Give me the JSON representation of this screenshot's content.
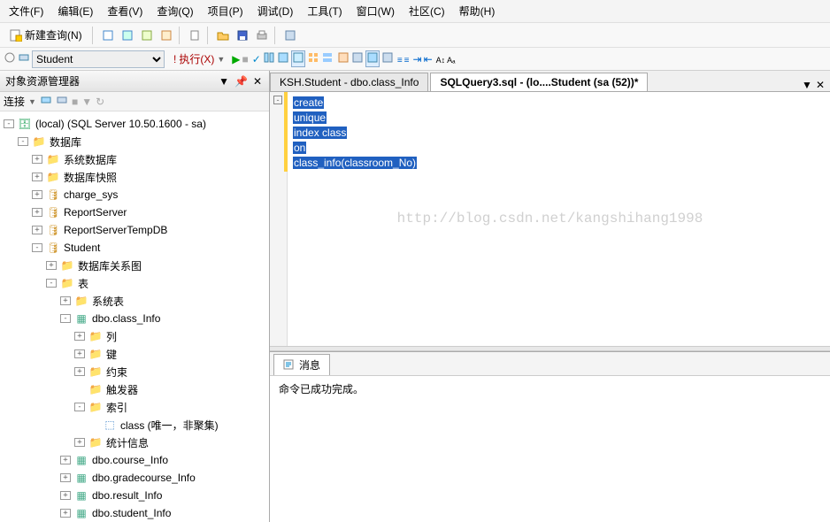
{
  "menu": {
    "file": "文件(F)",
    "edit": "编辑(E)",
    "view": "查看(V)",
    "query": "查询(Q)",
    "project": "项目(P)",
    "debug": "调试(D)",
    "tools": "工具(T)",
    "window": "窗口(W)",
    "community": "社区(C)",
    "help": "帮助(H)"
  },
  "toolbar": {
    "new_query": "新建查询(N)"
  },
  "toolbar2": {
    "db_select": "Student",
    "execute": "执行(X)"
  },
  "sidebar": {
    "title": "对象资源管理器",
    "connect": "连接"
  },
  "tree": {
    "server": "(local) (SQL Server 10.50.1600 - sa)",
    "databases": "数据库",
    "sys_db": "系统数据库",
    "db_snapshot": "数据库快照",
    "charge_sys": "charge_sys",
    "reportserver": "ReportServer",
    "reportservertemp": "ReportServerTempDB",
    "student": "Student",
    "db_diagram": "数据库关系图",
    "tables": "表",
    "sys_tables": "系统表",
    "class_info": "dbo.class_Info",
    "columns": "列",
    "keys": "键",
    "constraints": "约束",
    "triggers": "触发器",
    "indexes": "索引",
    "class_index": "class (唯一，非聚集)",
    "stats": "统计信息",
    "course_info": "dbo.course_Info",
    "gradecourse": "dbo.gradecourse_Info",
    "result_info": "dbo.result_Info",
    "student_info": "dbo.student_Info"
  },
  "tabs": {
    "tab1": "KSH.Student - dbo.class_Info",
    "tab2": "SQLQuery3.sql - (lo....Student (sa (52))*"
  },
  "editor": {
    "line1": "create",
    "line2": "unique",
    "line3": "index class",
    "line4": "on",
    "line5": "class_info(classroom_No)"
  },
  "watermark": "http://blog.csdn.net/kangshihang1998",
  "output": {
    "tab_label": "消息",
    "message": "命令已成功完成。"
  }
}
